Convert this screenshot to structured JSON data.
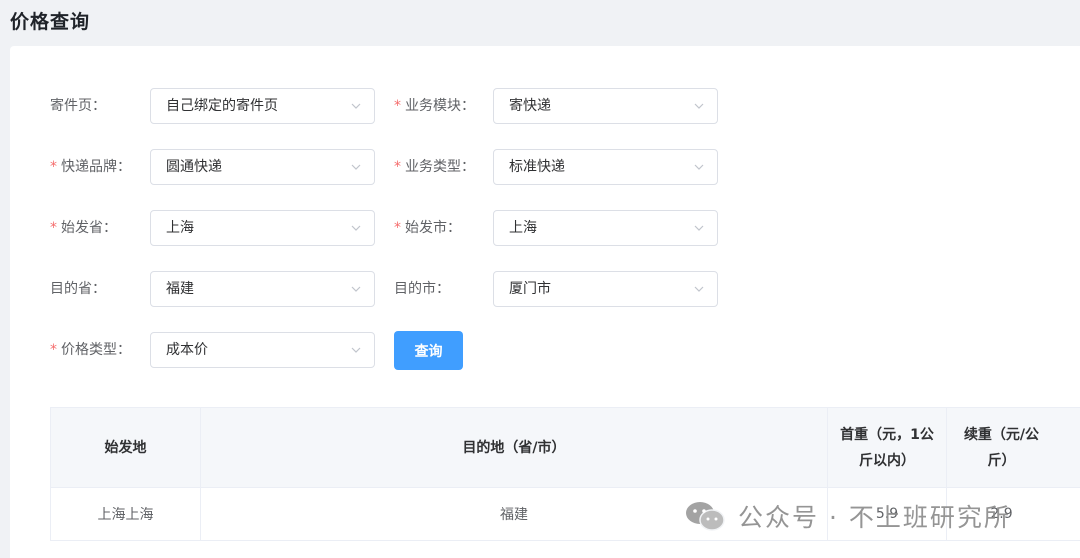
{
  "page": {
    "title": "价格查询"
  },
  "form": {
    "sender_page": {
      "label": "寄件页：",
      "required": false,
      "value": "自己绑定的寄件页"
    },
    "business_module": {
      "label": "业务模块：",
      "required": true,
      "value": "寄快递"
    },
    "express_brand": {
      "label": "快递品牌：",
      "required": true,
      "value": "圆通快递"
    },
    "business_type": {
      "label": "业务类型：",
      "required": true,
      "value": "标准快递"
    },
    "origin_province": {
      "label": "始发省：",
      "required": true,
      "value": "上海"
    },
    "origin_city": {
      "label": "始发市：",
      "required": true,
      "value": "上海"
    },
    "dest_province": {
      "label": "目的省：",
      "required": false,
      "value": "福建"
    },
    "dest_city": {
      "label": "目的市：",
      "required": false,
      "value": "厦门市"
    },
    "price_type": {
      "label": "价格类型：",
      "required": true,
      "value": "成本价"
    },
    "required_mark": "*",
    "query_button": "查询"
  },
  "table": {
    "headers": {
      "origin": "始发地",
      "destination": "目的地（省/市）",
      "first_weight": "首重（元，1公斤以内）",
      "additional_weight": "续重（元/公斤）"
    },
    "rows": [
      {
        "origin": "上海上海",
        "destination": "福建",
        "first_weight": "5.9",
        "additional_weight": "2.9"
      }
    ]
  },
  "watermark": {
    "text": "公众号 · 不上班研究所",
    "icon": "wechat-icon"
  },
  "colors": {
    "primary": "#409eff",
    "required": "#f56c6c",
    "background": "#f0f2f5"
  }
}
